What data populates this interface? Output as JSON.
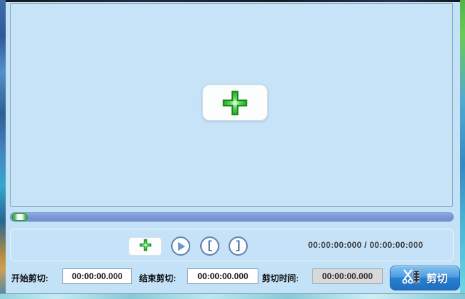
{
  "window": {
    "background": "#c3e1f7"
  },
  "colors": {
    "video_area_bg": "#c6e3f8",
    "slider_track": "#7896d6",
    "accent_green": "#2eae2e",
    "cut_button_top": "#7fc1f0",
    "cut_button_bottom": "#1f6fc2",
    "time_text": "#3c3c3c"
  },
  "video_area": {
    "add_button_icon": "plus-icon"
  },
  "slider": {
    "position_percent": 0
  },
  "toolbar": {
    "add_icon": "plus-icon",
    "play_icon": "play-icon",
    "mark_start_glyph": "[",
    "mark_end_glyph": "]",
    "time_display": "00:00:00:000 / 00:00:00:000"
  },
  "cut_bar": {
    "start_label": "开始剪切:",
    "start_value": "00:00:00.000",
    "end_label": "结束剪切:",
    "end_value": "00:00:00.000",
    "duration_label": "剪切时间:",
    "duration_value": "00:00:00.000",
    "cut_button_label": "剪切",
    "cut_button_icon": "scissors-film-icon"
  }
}
